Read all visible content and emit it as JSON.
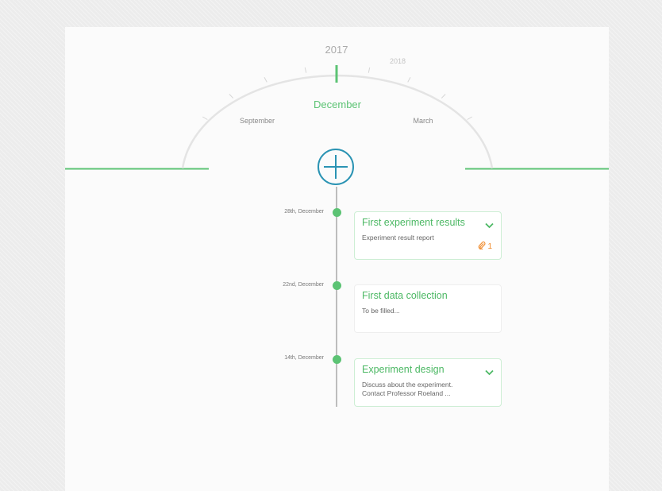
{
  "dial": {
    "year_current": "2017",
    "year_next": "2018",
    "month_current": "December",
    "month_left": "September",
    "month_right": "March"
  },
  "colors": {
    "accent_green": "#5cc374",
    "plus_blue": "#2a93b3",
    "attachment_orange": "#f08a2b"
  },
  "add_button": {
    "icon": "plus-icon"
  },
  "events": [
    {
      "date": "28th, December",
      "title": "First experiment results",
      "description": "Experiment result report",
      "attachment_count": "1",
      "expandable": true
    },
    {
      "date": "22nd, December",
      "title": "First data collection",
      "description": "To be filled...",
      "expandable": false
    },
    {
      "date": "14th, December",
      "title": "Experiment design",
      "description": "Discuss about the experiment.\nContact Professor Roeland ...",
      "expandable": true
    }
  ]
}
